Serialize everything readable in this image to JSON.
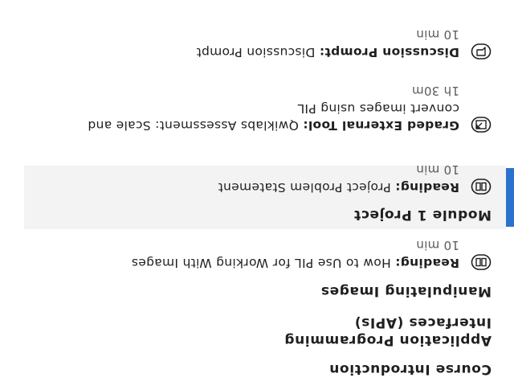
{
  "nav": {
    "sections": [
      {
        "heading": "Course Introduction"
      },
      {
        "heading": "Application Programming Interfaces (APIs)"
      },
      {
        "heading": "Manipulating Images"
      },
      {
        "heading": "Module 1 Project"
      }
    ],
    "items": [
      {
        "icon": "book-icon",
        "type": "Reading:",
        "title": "How to Use PIL for Working With Images",
        "duration": "10 min",
        "active": true
      },
      {
        "icon": "book-icon",
        "type": "Reading:",
        "title": "Project Problem Statement",
        "duration": "10 min",
        "active": false
      },
      {
        "icon": "external-tool-icon",
        "type": "Graded External Tool:",
        "title": "Qwiklabs Assessment: Scale and convert images using PIL",
        "duration": "1h 30m",
        "active": false
      },
      {
        "icon": "discussion-icon",
        "type": "Discussion Prompt:",
        "title": "Discussion Prompt",
        "duration": "10 min",
        "active": false
      }
    ]
  },
  "colors": {
    "accent": "#2a73cc",
    "active_bg": "#f3f3f3"
  }
}
